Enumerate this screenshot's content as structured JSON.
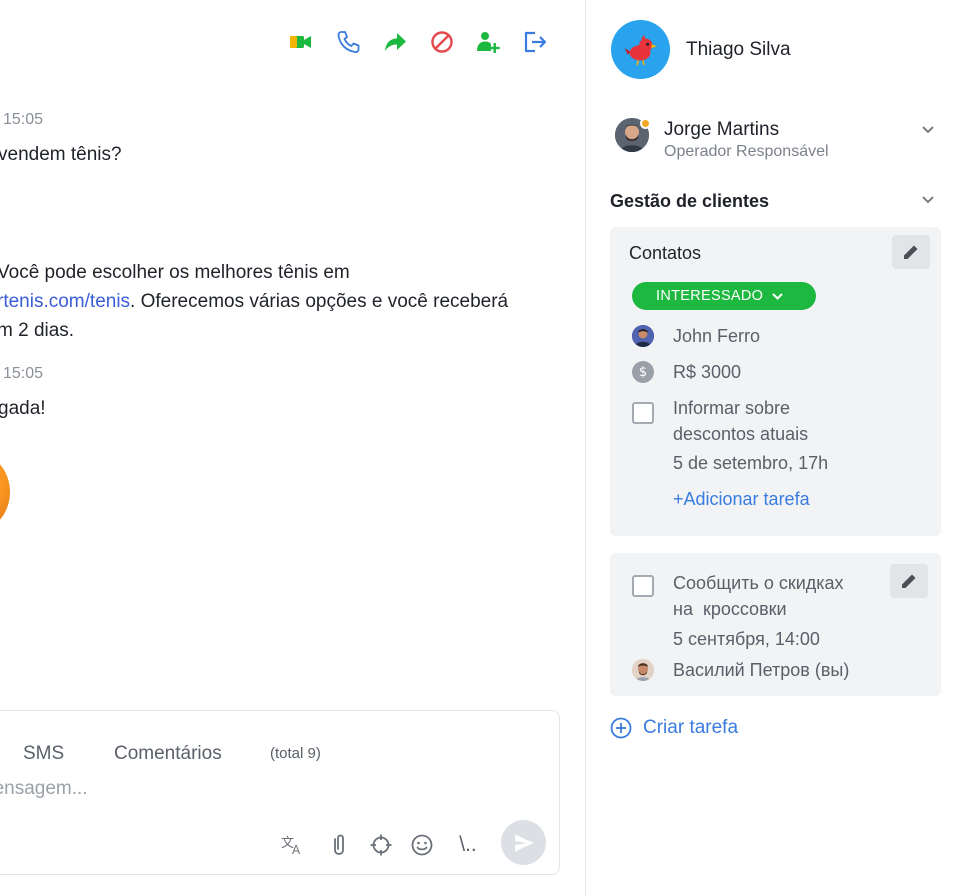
{
  "toolbar": {
    "icons": [
      "video-call-icon",
      "phone-icon",
      "forward-icon",
      "block-icon",
      "add-user-icon",
      "logout-icon"
    ],
    "colors": {
      "video": "#1db83f",
      "phone": "#3a7be0",
      "forward": "#1db83f",
      "block": "#e5484d",
      "add_user": "#1db83f",
      "logout": "#3a7be0"
    }
  },
  "messages": [
    {
      "time": "15:05",
      "lines": [
        "vendem tênis?"
      ]
    },
    {
      "lines": [
        "Você pode escolher os melhores tênis em"
      ],
      "link": "rtenis.com/tenis",
      "after_link": ". Oferecemos várias opções e você receberá",
      "last_line": "m 2 dias."
    },
    {
      "time": "15:05",
      "lines": [
        "gada!"
      ]
    }
  ],
  "composer": {
    "tabs": [
      "SMS",
      "Comentários"
    ],
    "total": "(total 9)",
    "placeholder": "nensagem...",
    "icons": [
      "translate-icon",
      "attach-icon",
      "crosshair-icon",
      "emoji-icon",
      "template-icon"
    ],
    "template_glyph": "\\.."
  },
  "client": {
    "name": "Thiago Silva",
    "avatar_color": "#2aa3ee"
  },
  "operator": {
    "name": "Jorge Martins",
    "role": "Operador Responsável",
    "status_color": "#f5a623"
  },
  "section": {
    "title": "Gestão de clientes"
  },
  "card1": {
    "title": "Contatos",
    "status": "INTERESSADO",
    "status_color": "#1db83f",
    "contact": "John Ferro",
    "amount": "R$ 3000",
    "task_line1": "Informar sobre",
    "task_line2": "descontos atuais",
    "task_date": "5 de setembro, 17h",
    "add_task": "+Adicionar tarefa"
  },
  "card2": {
    "task_line1": "Сообщить о скидках",
    "task_line2": "на  кроссовки",
    "task_date": "5 сентября, 14:00",
    "assignee": "Василий Петров (вы)"
  },
  "create_task": {
    "label": "Criar tarefa"
  }
}
